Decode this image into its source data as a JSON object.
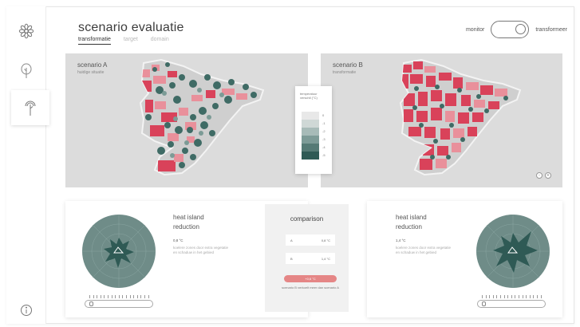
{
  "header": {
    "title": "scenario evaluatie",
    "tabs": [
      {
        "label": "transformatie",
        "active": true
      },
      {
        "label": "target",
        "active": false
      },
      {
        "label": "domain",
        "active": false
      }
    ],
    "toggle": {
      "left_label": "monitor",
      "right_label": "transformeer",
      "state": "right"
    }
  },
  "sidebar": {
    "items": [
      {
        "icon": "flower-icon"
      },
      {
        "icon": "tree-icon"
      },
      {
        "icon": "tree-plant-icon",
        "active": true
      },
      {
        "icon": "info-icon"
      }
    ]
  },
  "maps": {
    "left": {
      "label": "scenario A",
      "sub": "huidige situatie"
    },
    "right": {
      "label": "scenario B",
      "sub": "transformatie"
    }
  },
  "legend": {
    "title": "temperatuur verschil (°C)",
    "ticks": [
      "-5",
      "-4",
      "-3",
      "-2",
      "-1",
      "0"
    ]
  },
  "zoom": {
    "out": "-",
    "in": "+"
  },
  "bottom": {
    "left": {
      "title_1": "heat island",
      "title_2": "reduction",
      "value": "0,8 °C",
      "text": "koelere zones door extra vegetatie en schaduw in het gebied"
    },
    "right": {
      "title_1": "heat island",
      "title_2": "reduction",
      "value": "1,4 °C",
      "text": "koelere zones door extra vegetatie en schaduw in het gebied"
    }
  },
  "comparison": {
    "title": "comparison",
    "rows": [
      {
        "label": "A",
        "value": "0,8 °C"
      },
      {
        "label": "B",
        "value": "1,4 °C"
      }
    ],
    "button": "+0,6 °C",
    "note": "scenario B verkoelt meer dan scenario A"
  },
  "colors": {
    "accent_red": "#d9425a",
    "pink": "#e9909b",
    "teal_dark": "#2f5a55",
    "radial_bg": "#6f8c88"
  }
}
